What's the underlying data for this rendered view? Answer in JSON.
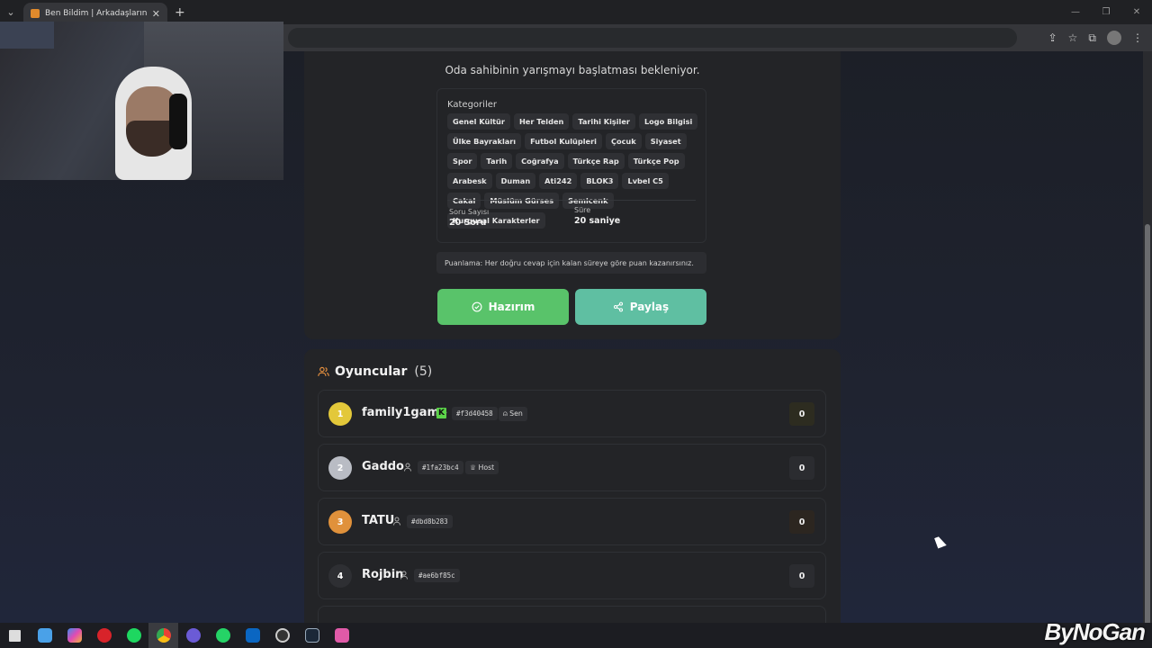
{
  "browser": {
    "tab_title": "Ben Bildim | Arkadaşlarınla Onli",
    "tab_close": "✕",
    "new_tab": "+",
    "dropdown": "⌄",
    "window_controls": [
      "—",
      "❐",
      "✕"
    ]
  },
  "lobby": {
    "subtitle": "Oda sahibinin yarışmayı başlatması bekleniyor.",
    "categories_label": "Kategoriler",
    "categories": [
      "Genel Kültür",
      "Her Telden",
      "Tarihi Kişiler",
      "Logo Bilgisi",
      "Ülke Bayrakları",
      "Futbol Kulüpleri",
      "Çocuk",
      "Siyaset",
      "Spor",
      "Tarih",
      "Coğrafya",
      "Türkçe Rap",
      "Türkçe Pop",
      "Arabesk",
      "Duman",
      "Ati242",
      "BLOK3",
      "Lvbel C5",
      "Cakal",
      "Müslüm Gürses",
      "Semicenk",
      "Kurgusal Karakterler"
    ],
    "question_count_label": "Soru Sayısı",
    "question_count_value": "20 Soru",
    "duration_label": "Süre",
    "duration_value": "20 saniye",
    "scoring_note": "Puanlama: Her doğru cevap için kalan süreye göre puan kazanırsınız.",
    "ready_button": "Hazırım",
    "share_button": "Paylaş"
  },
  "players": {
    "title": "Oyuncular",
    "count": "(5)",
    "list": [
      {
        "rank": "1",
        "name": "family1game",
        "tag": "#f3d40458",
        "badge": "Sen",
        "score": "0"
      },
      {
        "rank": "2",
        "name": "Gaddo",
        "tag": "#1fa23bc4",
        "badge": "Host",
        "score": "0"
      },
      {
        "rank": "3",
        "name": "TATU",
        "tag": "#dbd8b283",
        "score": "0"
      },
      {
        "rank": "4",
        "name": "Rojbin",
        "tag": "#ae6bf85c",
        "score": "0"
      }
    ]
  },
  "colors": {
    "rank1": "#e3c83a",
    "rank2": "#b9bcc4",
    "rank3": "#e0913b",
    "rank4": "#2e2f33",
    "ready": "#59c36a",
    "share": "#5fbfa2",
    "kick_badge": "#5cd34a"
  },
  "kick_letter": "K",
  "watermark": "ByNoGan"
}
